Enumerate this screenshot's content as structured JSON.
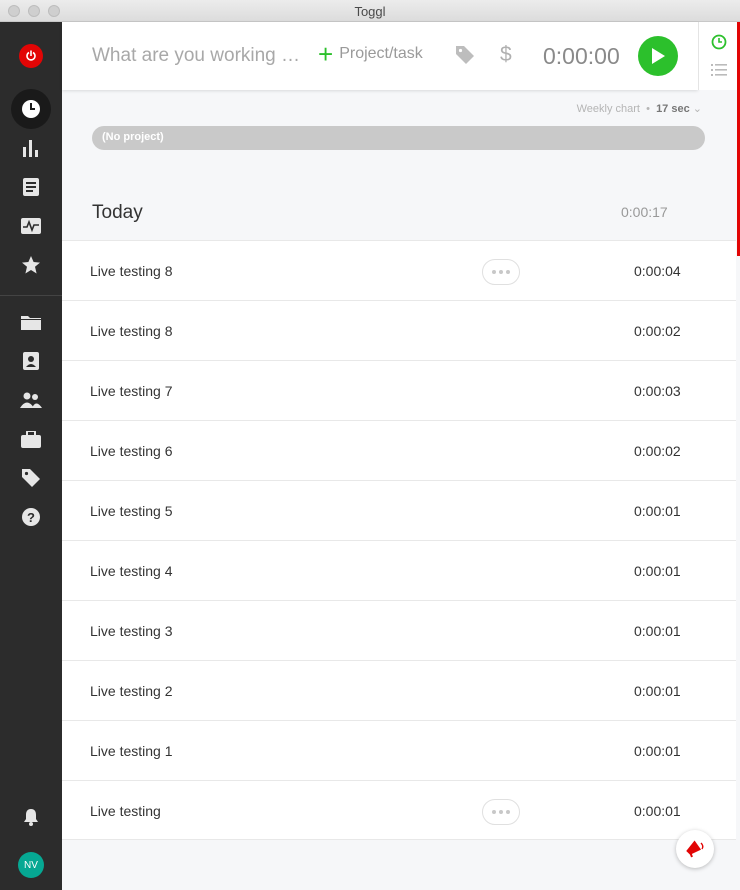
{
  "window": {
    "title": "Toggl"
  },
  "timer": {
    "description_placeholder": "What are you working on?",
    "project_label": "Project/task",
    "duration": "0:00:00"
  },
  "chart": {
    "label": "Weekly chart",
    "separator": "•",
    "total": "17 sec"
  },
  "project_bar": {
    "label": "(No project)"
  },
  "day": {
    "label": "Today",
    "total": "0:00:17"
  },
  "entries": [
    {
      "name": "Live testing 8",
      "duration": "0:00:04",
      "show_more": true
    },
    {
      "name": "Live testing 8",
      "duration": "0:00:02",
      "show_more": false
    },
    {
      "name": "Live testing 7",
      "duration": "0:00:03",
      "show_more": false
    },
    {
      "name": "Live testing 6",
      "duration": "0:00:02",
      "show_more": false
    },
    {
      "name": "Live testing 5",
      "duration": "0:00:01",
      "show_more": false
    },
    {
      "name": "Live testing 4",
      "duration": "0:00:01",
      "show_more": false
    },
    {
      "name": "Live testing 3",
      "duration": "0:00:01",
      "show_more": false
    },
    {
      "name": "Live testing 2",
      "duration": "0:00:01",
      "show_more": false
    },
    {
      "name": "Live testing 1",
      "duration": "0:00:01",
      "show_more": false
    },
    {
      "name": "Live testing",
      "duration": "0:00:01",
      "show_more": true
    }
  ],
  "sidebar": {
    "icons": [
      "power-icon",
      "timer-icon",
      "reports-icon",
      "insights-icon",
      "activity-icon",
      "goals-icon",
      "projects-icon",
      "clients-icon",
      "team-icon",
      "workspaces-icon",
      "tags-icon",
      "help-icon",
      "bell-icon"
    ],
    "avatar_initials": "NV"
  },
  "colors": {
    "accent": "#2cc02c",
    "power": "#e20505",
    "sidebar": "#2c2c2c",
    "avatar": "#06a893"
  }
}
